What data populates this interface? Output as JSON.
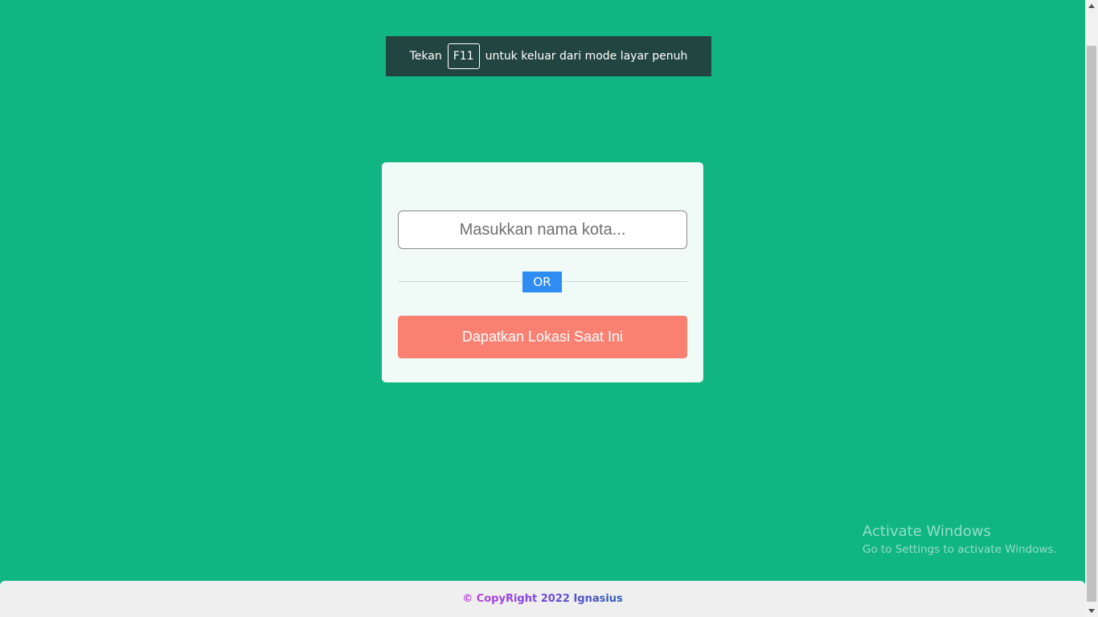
{
  "fullscreen_notice": {
    "prefix": "Tekan",
    "key": "F11",
    "suffix": "untuk keluar dari mode layar penuh"
  },
  "search": {
    "placeholder": "Masukkan nama kota...",
    "value": ""
  },
  "divider": {
    "label": "OR"
  },
  "location_button": {
    "label": "Dapatkan Lokasi Saat Ini"
  },
  "watermark": {
    "title": "Activate Windows",
    "subtitle": "Go to Settings to activate Windows."
  },
  "footer": {
    "text": "© CopyRight 2022 Ignasius"
  },
  "colors": {
    "background": "#10b582",
    "card": "#f0fbf8",
    "or_badge": "#2f8cf2",
    "button": "#fa8072",
    "banner": "#234541"
  }
}
